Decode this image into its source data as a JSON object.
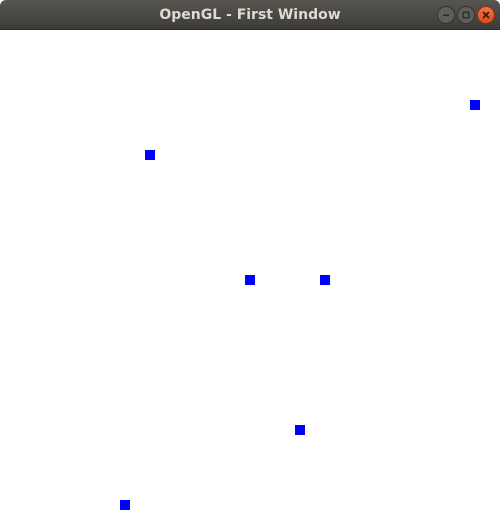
{
  "window": {
    "title": "OpenGL - First Window"
  },
  "controls": {
    "minimize_icon": "minimize-icon",
    "maximize_icon": "maximize-icon",
    "close_icon": "close-icon"
  },
  "canvas": {
    "background": "#ffffff",
    "point_color": "#0000ff",
    "points": [
      {
        "x": 0.9,
        "y": 0.7
      },
      {
        "x": -0.4,
        "y": 0.5
      },
      {
        "x": 0.0,
        "y": 0.0
      },
      {
        "x": 0.3,
        "y": 0.0
      },
      {
        "x": 0.2,
        "y": -0.6
      },
      {
        "x": -0.5,
        "y": -0.9
      }
    ]
  }
}
